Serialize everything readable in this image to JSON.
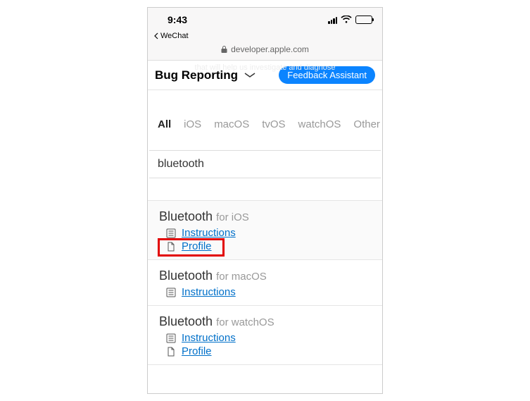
{
  "status": {
    "time": "9:43",
    "back_app": "WeChat",
    "url": "developer.apple.com"
  },
  "subheader": {
    "title": "Bug Reporting",
    "button": "Feedback Assistant",
    "ghost": "that will help us investigate and diagnose"
  },
  "tabs": [
    "All",
    "iOS",
    "macOS",
    "tvOS",
    "watchOS",
    "Other"
  ],
  "search": {
    "value": "bluetooth"
  },
  "results": [
    {
      "name": "Bluetooth",
      "platform": "for iOS",
      "links": [
        {
          "label": "Instructions",
          "icon": "list"
        },
        {
          "label": "Profile",
          "icon": "doc",
          "highlight": true
        }
      ],
      "highlighted": true
    },
    {
      "name": "Bluetooth",
      "platform": "for macOS",
      "links": [
        {
          "label": "Instructions",
          "icon": "list"
        }
      ]
    },
    {
      "name": "Bluetooth",
      "platform": "for watchOS",
      "links": [
        {
          "label": "Instructions",
          "icon": "list"
        },
        {
          "label": "Profile",
          "icon": "doc"
        }
      ]
    }
  ]
}
